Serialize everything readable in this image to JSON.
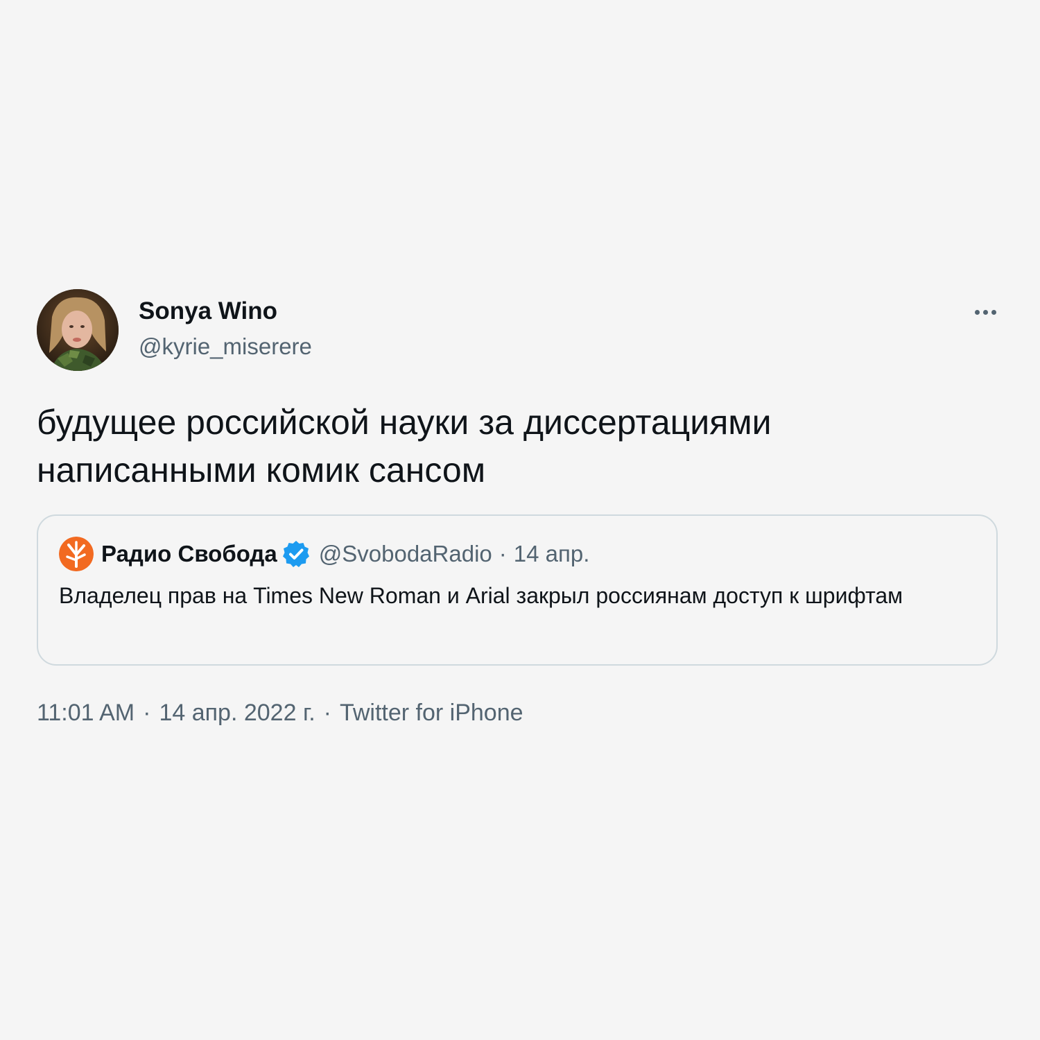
{
  "author": {
    "name": "Sonya Wino",
    "handle": "@kyrie_miserere"
  },
  "tweet": {
    "text": "будущее российской науки за диссертациями написанными комик сансом"
  },
  "quoted": {
    "name": "Радио Свобода",
    "handle": "@SvobodaRadio",
    "separator": "·",
    "date": "14 апр.",
    "text": "Владелец прав на Times New Roman и Arial закрыл россиянам доступ к шрифтам"
  },
  "meta": {
    "time": "11:01 AM",
    "separator": "·",
    "date": "14 апр. 2022 г.",
    "source": "Twitter for iPhone"
  },
  "icons": {
    "more": "more-horizontal-icon",
    "verified": "verified-badge-icon",
    "logo": "radio-svoboda-logo"
  },
  "colors": {
    "background": "#f5f5f5",
    "text_primary": "#0f1419",
    "text_secondary": "#536471",
    "border": "#cfd9de",
    "verified_blue": "#1d9bf0",
    "logo_orange": "#f26a21"
  }
}
